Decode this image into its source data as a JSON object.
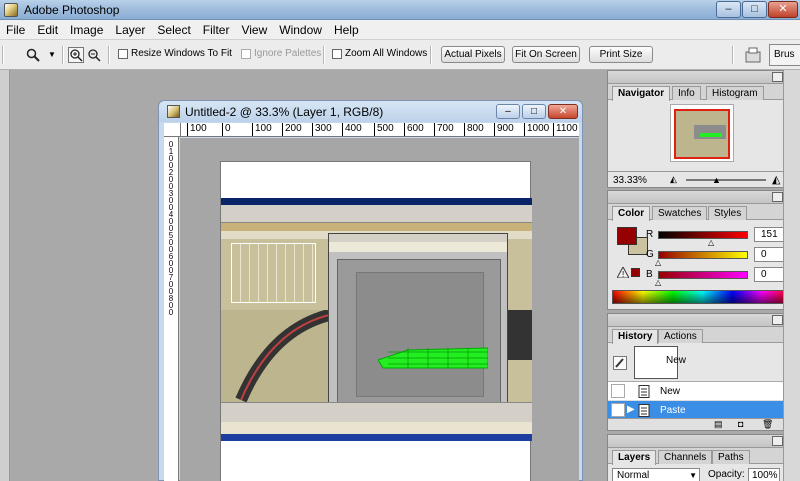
{
  "window": {
    "title": "Adobe Photoshop"
  },
  "menu": [
    "File",
    "Edit",
    "Image",
    "Layer",
    "Select",
    "Filter",
    "View",
    "Window",
    "Help"
  ],
  "options": {
    "resize_windows_label": "Resize Windows To Fit",
    "ignore_palettes_label": "Ignore Palettes",
    "zoom_all_label": "Zoom All Windows",
    "actual_pixels": "Actual Pixels",
    "fit_on_screen": "Fit On Screen",
    "print_size": "Print Size",
    "brushes_tab": "Brus"
  },
  "document": {
    "title": "Untitled-2 @ 33.3% (Layer 1, RGB/8)",
    "ruler_h": [
      "100",
      "0",
      "100",
      "200",
      "300",
      "400",
      "500",
      "600",
      "700",
      "800",
      "900",
      "1000",
      "1100"
    ],
    "ruler_v": [
      "0",
      "1",
      "0",
      "0",
      "2",
      "0",
      "0",
      "3",
      "0",
      "0",
      "4",
      "0",
      "0",
      "5",
      "0",
      "0",
      "6",
      "0",
      "0",
      "7",
      "0",
      "0",
      "8",
      "0",
      "0"
    ]
  },
  "navigator": {
    "tabs": [
      "Navigator",
      "Info",
      "Histogram"
    ],
    "zoom": "33.33%"
  },
  "color": {
    "tabs": [
      "Color",
      "Swatches",
      "Styles"
    ],
    "r_label": "R",
    "g_label": "G",
    "b_label": "B",
    "r": "151",
    "g": "0",
    "b": "0",
    "foreground": "#970000",
    "background": "#cbc3a0"
  },
  "history": {
    "tabs": [
      "History",
      "Actions"
    ],
    "snapshot": "New",
    "items": [
      "New",
      "Paste"
    ]
  },
  "layers": {
    "tabs": [
      "Layers",
      "Channels",
      "Paths"
    ],
    "blend_mode": "Normal",
    "opacity_label": "Opacity:",
    "opacity": "100%"
  }
}
